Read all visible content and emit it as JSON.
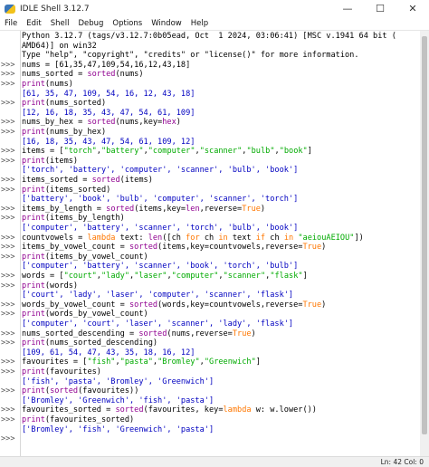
{
  "window": {
    "title": "IDLE Shell 3.12.7",
    "minimize_glyph": "—",
    "maximize_glyph": "☐",
    "close_glyph": "✕"
  },
  "menu": [
    "File",
    "Edit",
    "Shell",
    "Debug",
    "Options",
    "Window",
    "Help"
  ],
  "shell": {
    "prompt": ">>>",
    "lines": [
      {
        "p": false,
        "t": "Python 3.12.7 (tags/v3.12.7:0b05ead, Oct  1 2024, 03:06:41) [MSC v.1941 64 bit ("
      },
      {
        "p": false,
        "t": "AMD64)] on win32"
      },
      {
        "p": false,
        "t": "Type \"help\", \"copyright\", \"credits\" or \"license()\" for more information."
      },
      {
        "p": true,
        "t": "nums = [61,35,47,109,54,16,12,43,18]"
      },
      {
        "p": true,
        "t": "nums_sorted = sorted(nums)"
      },
      {
        "p": true,
        "t": "print(nums)"
      },
      {
        "p": false,
        "t": "[61, 35, 47, 109, 54, 16, 12, 43, 18]",
        "out": true
      },
      {
        "p": true,
        "t": "print(nums_sorted)"
      },
      {
        "p": false,
        "t": "[12, 16, 18, 35, 43, 47, 54, 61, 109]",
        "out": true
      },
      {
        "p": true,
        "t": "nums_by_hex = sorted(nums,key=hex)"
      },
      {
        "p": true,
        "t": "print(nums_by_hex)"
      },
      {
        "p": false,
        "t": "[16, 18, 35, 43, 47, 54, 61, 109, 12]",
        "out": true
      },
      {
        "p": true,
        "t": "items = [\"torch\",\"battery\",\"computer\",\"scanner\",\"bulb\",\"book\"]"
      },
      {
        "p": true,
        "t": "print(items)"
      },
      {
        "p": false,
        "t": "['torch', 'battery', 'computer', 'scanner', 'bulb', 'book']",
        "out": true
      },
      {
        "p": true,
        "t": "items_sorted = sorted(items)"
      },
      {
        "p": true,
        "t": "print(items_sorted)"
      },
      {
        "p": false,
        "t": "['battery', 'book', 'bulb', 'computer', 'scanner', 'torch']",
        "out": true
      },
      {
        "p": true,
        "t": "items_by_length = sorted(items,key=len,reverse=True)"
      },
      {
        "p": true,
        "t": "print(items_by_length)"
      },
      {
        "p": false,
        "t": "['computer', 'battery', 'scanner', 'torch', 'bulb', 'book']",
        "out": true
      },
      {
        "p": true,
        "t": "countvowels = lambda text: len([ch for ch in text if ch in \"aeiouAEIOU\"])"
      },
      {
        "p": true,
        "t": "items_by_vowel_count = sorted(items,key=countvowels,reverse=True)"
      },
      {
        "p": true,
        "t": "print(items_by_vowel_count)"
      },
      {
        "p": false,
        "t": "['computer', 'battery', 'scanner', 'book', 'torch', 'bulb']",
        "out": true
      },
      {
        "p": true,
        "t": "words = [\"court\",\"lady\",\"laser\",\"computer\",\"scanner\",\"flask\"]"
      },
      {
        "p": true,
        "t": "print(words)"
      },
      {
        "p": false,
        "t": "['court', 'lady', 'laser', 'computer', 'scanner', 'flask']",
        "out": true
      },
      {
        "p": true,
        "t": "words_by_vowel_count = sorted(words,key=countvowels,reverse=True)"
      },
      {
        "p": true,
        "t": "print(words_by_vowel_count)"
      },
      {
        "p": false,
        "t": "['computer', 'court', 'laser', 'scanner', 'lady', 'flask']",
        "out": true
      },
      {
        "p": true,
        "t": "nums_sorted_descending = sorted(nums,reverse=True)"
      },
      {
        "p": true,
        "t": "print(nums_sorted_descending)"
      },
      {
        "p": false,
        "t": "[109, 61, 54, 47, 43, 35, 18, 16, 12]",
        "out": true
      },
      {
        "p": true,
        "t": "favourites = [\"fish\",\"pasta\",\"Bromley\",\"Greenwich\"]"
      },
      {
        "p": true,
        "t": "print(favourites)"
      },
      {
        "p": false,
        "t": "['fish', 'pasta', 'Bromley', 'Greenwich']",
        "out": true
      },
      {
        "p": true,
        "t": "print(sorted(favourites))"
      },
      {
        "p": false,
        "t": "['Bromley', 'Greenwich', 'fish', 'pasta']",
        "out": true
      },
      {
        "p": true,
        "t": "favourites_sorted = sorted(favourites, key=lambda w: w.lower())"
      },
      {
        "p": true,
        "t": "print(favourites_sorted)"
      },
      {
        "p": false,
        "t": "['Bromley', 'fish', 'Greenwich', 'pasta']",
        "out": true
      },
      {
        "p": true,
        "t": ""
      }
    ]
  },
  "status": {
    "position": "Ln: 42   Col: 0"
  }
}
